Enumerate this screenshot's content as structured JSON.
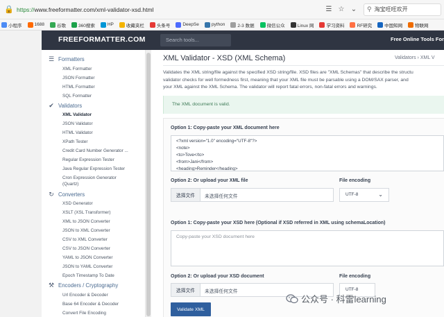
{
  "browser": {
    "url_scheme": "https://",
    "url_rest": "www.freeformatter.com/xml-validator-xsd.html",
    "search_text": "淘宝旺旺欢开",
    "bookmarks": [
      {
        "label": "小程序",
        "color": "#4c8bf5"
      },
      {
        "label": "1688",
        "color": "#ff6a00"
      },
      {
        "label": "谷歌",
        "color": "#34a853"
      },
      {
        "label": "360搜索",
        "color": "#1ba24a"
      },
      {
        "label": "HP",
        "color": "#0096d6"
      },
      {
        "label": "收藏夹栏",
        "color": "#f4b400"
      },
      {
        "label": "头条号",
        "color": "#e53935"
      },
      {
        "label": "DeepSe",
        "color": "#4d6bfe"
      },
      {
        "label": "python",
        "color": "#3776ab"
      },
      {
        "label": "2-3 数据",
        "color": "#9e9e9e"
      },
      {
        "label": "微信公众",
        "color": "#07c160"
      },
      {
        "label": "Linux 网",
        "color": "#333333"
      },
      {
        "label": "学习资料",
        "color": "#e53935"
      },
      {
        "label": "RF研究",
        "color": "#ff7043"
      },
      {
        "label": "中国知网",
        "color": "#1565c0"
      },
      {
        "label": "物联网",
        "color": "#ef6c00"
      }
    ]
  },
  "site": {
    "logo": "FREEFORMATTER.COM",
    "search_placeholder": "Search tools...",
    "tagline": "Free Online Tools For D"
  },
  "sidebar": {
    "sections": [
      {
        "title": "Formatters",
        "icon": "align-left-icon",
        "items": [
          "XML Formatter",
          "JSON Formatter",
          "HTML Formatter",
          "SQL Formatter"
        ]
      },
      {
        "title": "Validators",
        "icon": "check-icon",
        "items": [
          "XML Validator",
          "JSON Validator",
          "HTML Validator",
          "XPath Tester",
          "Credit Card Number Generator ...",
          "Regular Expression Tester",
          "Java Regular Expression Tester",
          "Cron Expression Generator",
          "(Quartz)"
        ]
      },
      {
        "title": "Converters",
        "icon": "refresh-icon",
        "items": [
          "XSD Generator",
          "XSLT (XSL Transformer)",
          "XML to JSON Converter",
          "JSON to XML Converter",
          "CSV to XML Converter",
          "CSV to JSON Converter",
          "YAML to JSON Converter",
          "JSON to YAML Converter",
          "Epoch Timestamp To Date"
        ]
      },
      {
        "title": "Encoders / Cryptography",
        "icon": "wrench-icon",
        "items": [
          "Url Encoder & Decoder",
          "Base 64 Encoder & Decoder",
          "Convert File Encoding"
        ]
      }
    ]
  },
  "main": {
    "title": "XML Validator - XSD (XML Schema)",
    "breadcrumb": "Validators  ›  XML V",
    "description": [
      "Validates the XML string/file against the specified XSD string/file. XSD files are \"XML Schemas\" that describe the structu",
      "validator checks for well formedness first, meaning that your XML file must be parsable using a DOM/SAX parser, and",
      "your XML against the XML Schema. The validator will report fatal errors, non-fatal errors and warnings."
    ],
    "alert": "The XML document is valid.",
    "option1_xml_label": "Option 1: Copy-paste your XML document here",
    "xml_lines": [
      "<?xml version=\"1.0\" encoding=\"UTF-8\"?>",
      "<note>",
      "<to>Tove</to>",
      "<from>Jani</from>",
      "<heading>Reminder</heading>"
    ],
    "option2_xml_label": "Option 2: Or upload your XML file",
    "file_encoding_label": "File encoding",
    "choose_file_label": "选择文件",
    "no_file_text": "未选择任何文件",
    "encoding_value": "UTF-8",
    "option1_xsd_label": "Option 1: Copy-paste your XSD here (Optional if XSD referred in XML using schemaLocation)",
    "xsd_placeholder": "Copy-paste your XSD document here",
    "option2_xsd_label": "Option 2: Or upload your XSD document",
    "file_encoding_label_2": "File encoding",
    "choose_file_label_2": "选择文件",
    "no_file_text_2": "未选择任何文件",
    "encoding_value_2": "UTF-8",
    "validate_button": "Validate XML"
  },
  "watermark": {
    "text": "公众号 · 科雷learning"
  }
}
